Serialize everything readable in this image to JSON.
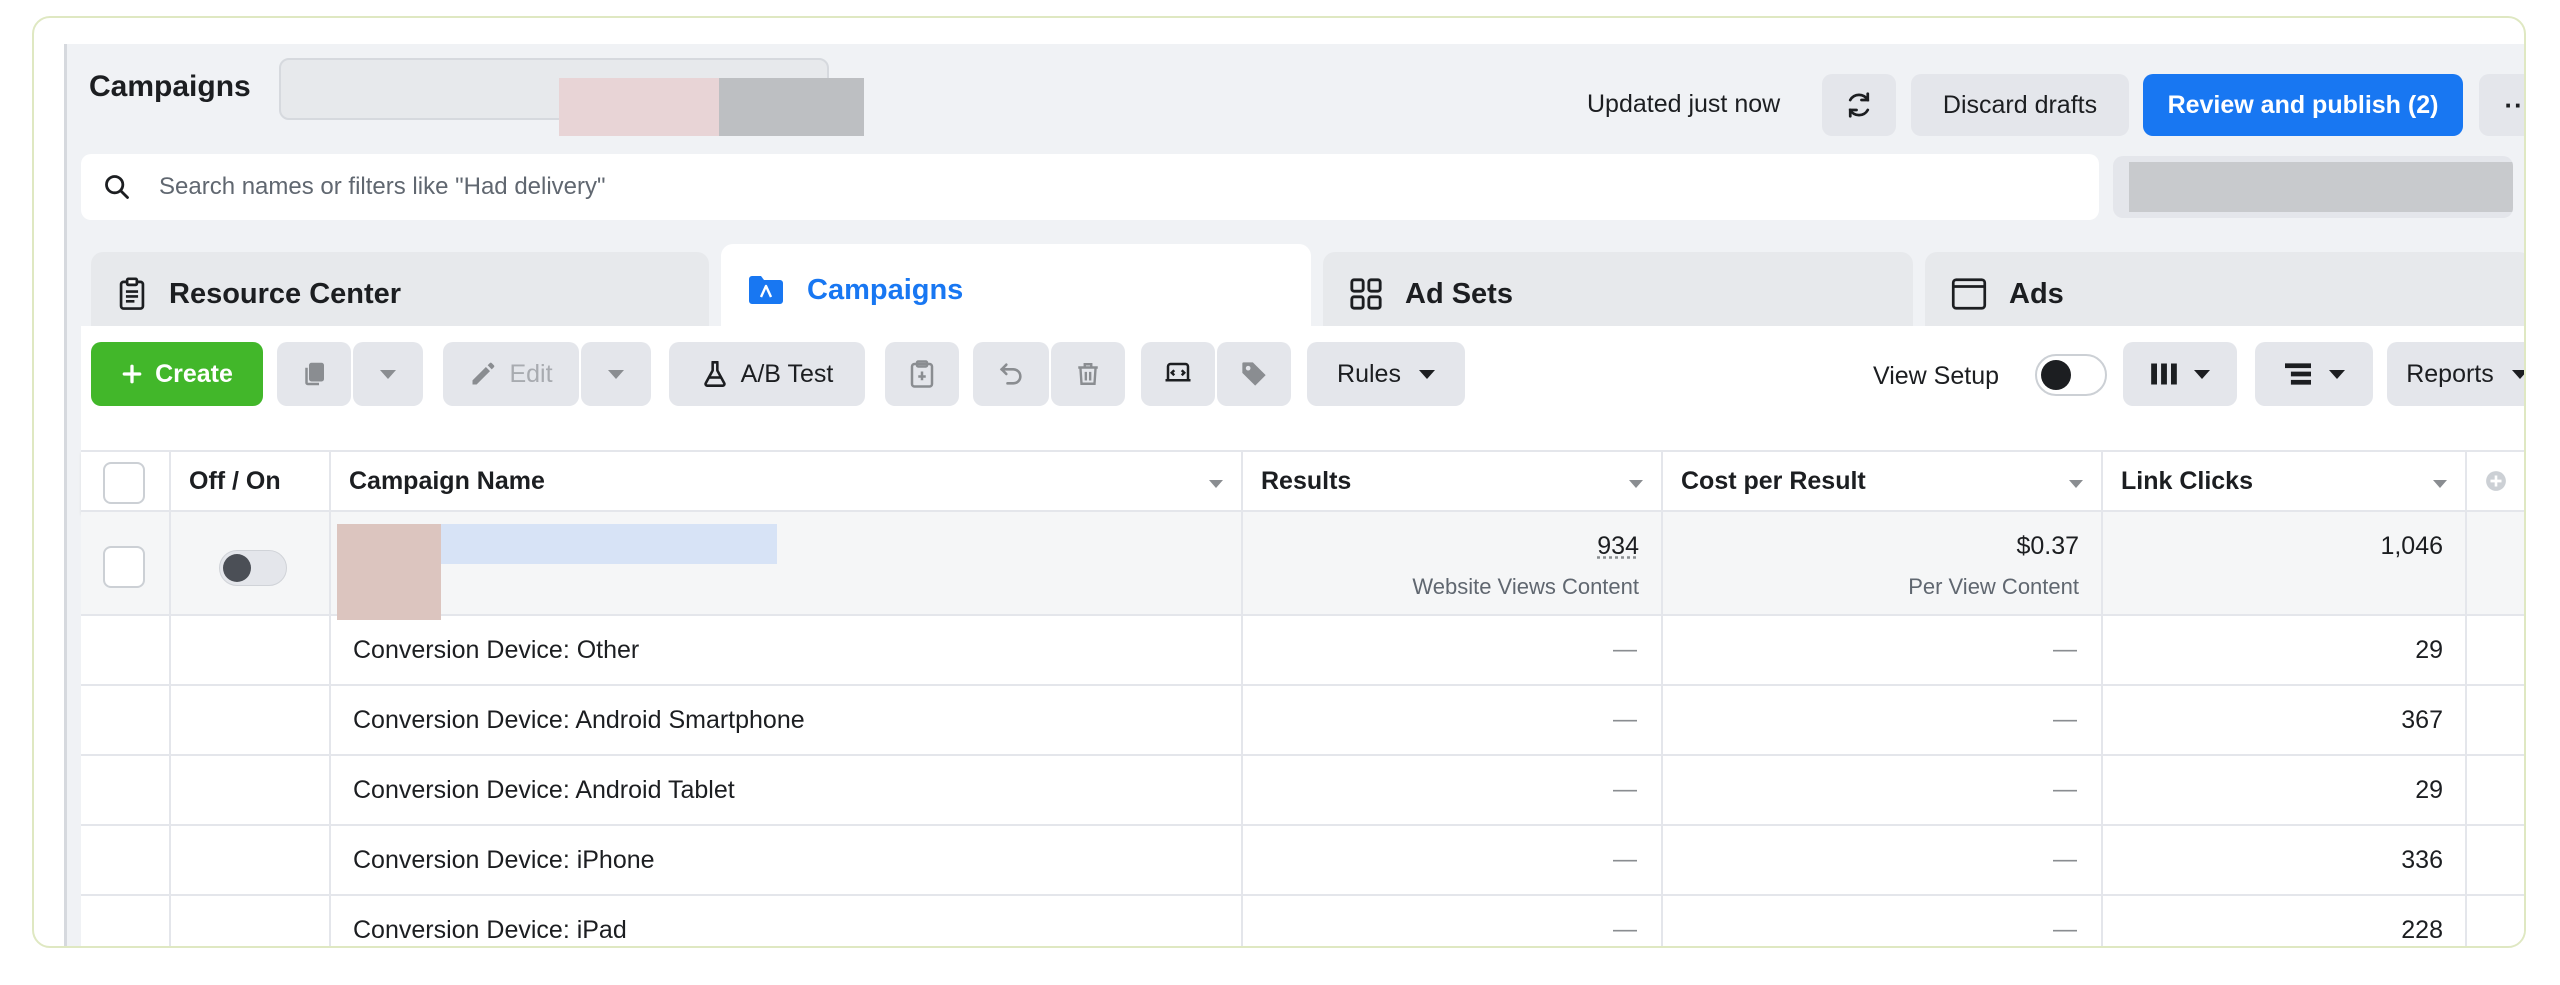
{
  "header": {
    "title": "Campaigns",
    "updated_text": "Updated just now",
    "discard_label": "Discard drafts",
    "publish_label": "Review and publish (2)",
    "more_label": "···"
  },
  "search": {
    "placeholder": "Search names or filters like \"Had delivery\""
  },
  "tabs": [
    {
      "label": "Resource Center",
      "icon": "clipboard-icon"
    },
    {
      "label": "Campaigns",
      "icon": "campaign-folder-icon",
      "active": true
    },
    {
      "label": "Ad Sets",
      "icon": "grid-icon"
    },
    {
      "label": "Ads",
      "icon": "ad-window-icon"
    }
  ],
  "toolbar": {
    "create_label": "Create",
    "edit_label": "Edit",
    "ab_test_label": "A/B Test",
    "rules_label": "Rules",
    "view_setup_label": "View Setup",
    "reports_label": "Reports"
  },
  "table": {
    "columns": [
      "Off / On",
      "Campaign Name",
      "Results",
      "Cost per Result",
      "Link Clicks"
    ],
    "campaign_row": {
      "results": "934",
      "results_sub": "Website Views Content",
      "cost": "$0.37",
      "cost_sub": "Per View Content",
      "link_clicks": "1,046"
    },
    "breakdown_rows": [
      {
        "name": "Conversion Device: Other",
        "results": "—",
        "cost": "—",
        "link_clicks": "29"
      },
      {
        "name": "Conversion Device: Android Smartphone",
        "results": "—",
        "cost": "—",
        "link_clicks": "367"
      },
      {
        "name": "Conversion Device: Android Tablet",
        "results": "—",
        "cost": "—",
        "link_clicks": "29"
      },
      {
        "name": "Conversion Device: iPhone",
        "results": "—",
        "cost": "—",
        "link_clicks": "336"
      },
      {
        "name": "Conversion Device: iPad",
        "results": "—",
        "cost": "—",
        "link_clicks": "228"
      }
    ]
  },
  "colors": {
    "primary": "#1877f2",
    "create": "#42b72a",
    "background": "#f0f2f5"
  }
}
